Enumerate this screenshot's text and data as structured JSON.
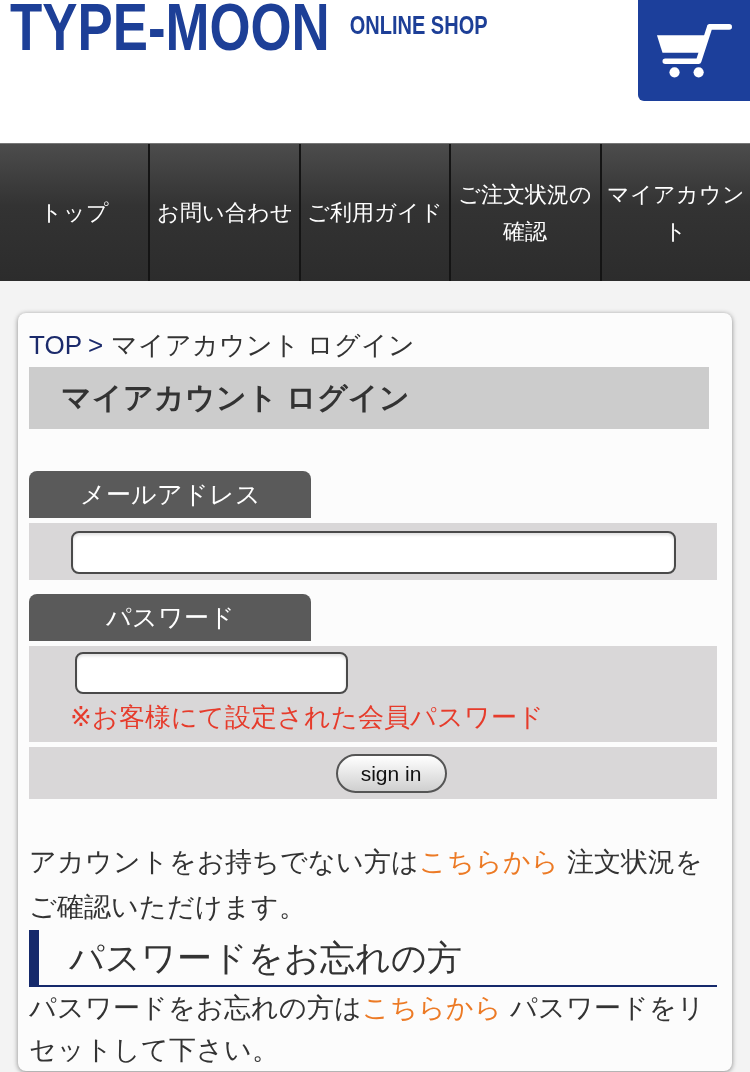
{
  "header": {
    "logo": "TYPE-MOON",
    "tagline": "ONLINE SHOP"
  },
  "nav": [
    {
      "label": "トップ"
    },
    {
      "label": "お問い合わせ"
    },
    {
      "label": "ご利用ガイド"
    },
    {
      "label": "ご注文状況の確認"
    },
    {
      "label": "マイアカウント"
    }
  ],
  "breadcrumb": {
    "items": [
      {
        "label": "TOP",
        "kind": "link"
      },
      {
        "label": "マイアカウント ログイン",
        "kind": "current"
      }
    ],
    "separator": ">"
  },
  "page_title": "マイアカウント ログイン",
  "form": {
    "fields": [
      {
        "label": "メールアドレス",
        "kind": "email"
      },
      {
        "label": "パスワード",
        "kind": "password",
        "note": "※お客様にて設定された会員パスワード"
      }
    ],
    "submit": "sign in"
  },
  "notice": {
    "before": "アカウントをお持ちでない方は",
    "link": "こちらから",
    "after": " 注文状況をご確認いただけます。"
  },
  "sections": [
    {
      "title": "パスワードをお忘れの方",
      "text": {
        "before": "パスワードをお忘れの方は",
        "link": "こちらから",
        "after": " パスワードをリセットして下さい。"
      }
    }
  ]
}
